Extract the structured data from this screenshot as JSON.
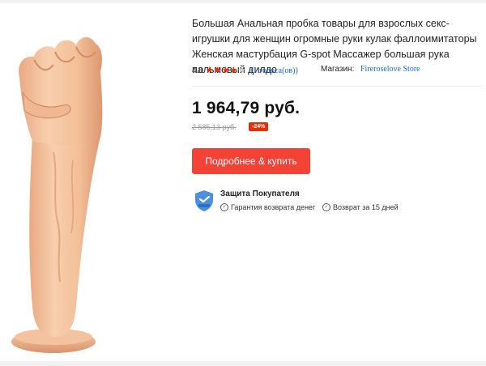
{
  "product": {
    "title": "Большая Анальная пробка товары для взрослых секс-игрушки для женщин огромные руки кулак фаллоимитаторы Женская мастурбация G-spot Массажер большая рука пальмовый дилдо",
    "rating": {
      "value": "4.0",
      "stars_filled": 4,
      "stars_total": 5,
      "votes_text": "(1 голоса(ов))"
    },
    "store": {
      "label": "Магазин:",
      "name": "Fireroselove Store"
    },
    "image": {
      "icon": "product-photo",
      "color": "#f5c7a2"
    }
  },
  "pricing": {
    "price": "1 964,79 руб.",
    "old_price": "2 585,13 руб.",
    "discount": "-24%"
  },
  "actions": {
    "buy_label": "Подробнее & купить"
  },
  "protection": {
    "title": "Защита Покупателя",
    "items": [
      {
        "icon": "check-circle-icon",
        "text": "Гарантия возврата денег"
      },
      {
        "icon": "check-circle-icon",
        "text": "Возврат за 15 дней"
      }
    ]
  },
  "colors": {
    "accent": "#f44336",
    "discount_badge": "#e62e04",
    "link": "#1a66c8",
    "shield": "#4a8fe0"
  }
}
